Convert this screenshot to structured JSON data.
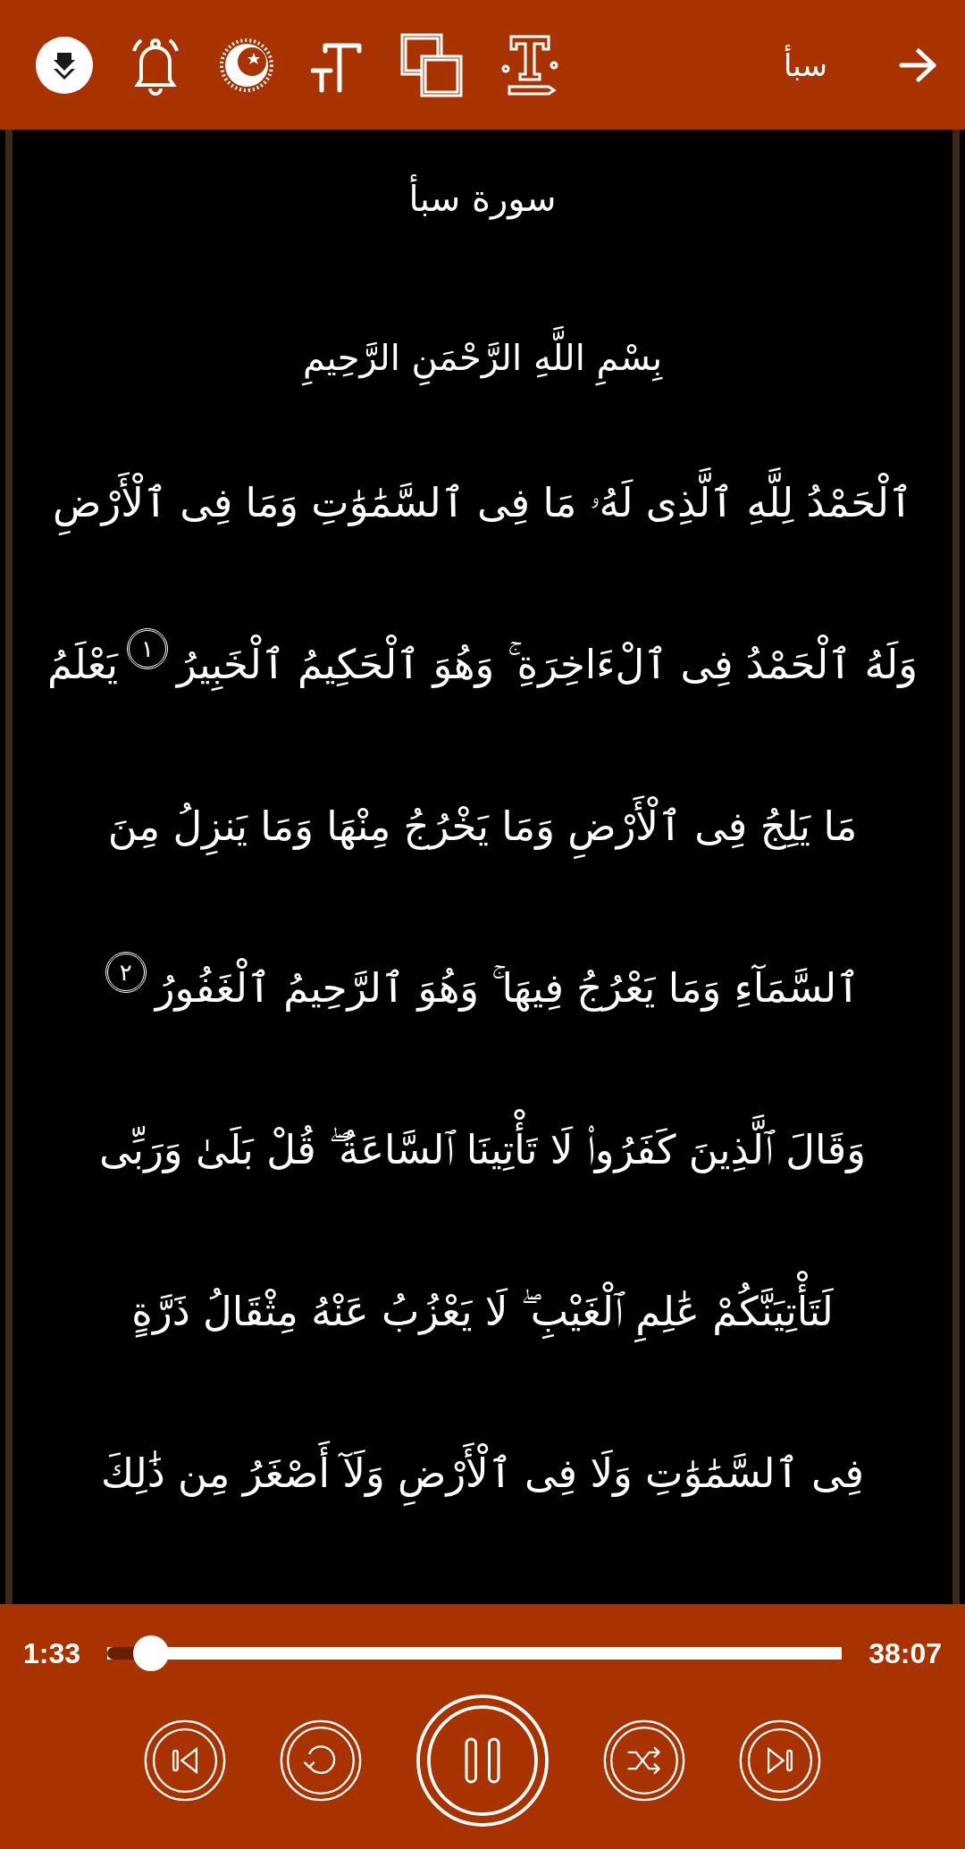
{
  "top_bar": {
    "title": "سبأ"
  },
  "surah": {
    "title": "سورة سبأ",
    "basmala": "بِسْمِ اللَّهِ الرَّحْمَنِ الرَّحِيمِ",
    "lines": [
      [
        {
          "kind": "text",
          "text": "ٱلْحَمْدُ لِلَّهِ ٱلَّذِى لَهُۥ مَا فِى ٱلسَّمَٰوَٰتِ وَمَا فِى ٱلْأَرْضِ"
        }
      ],
      [
        {
          "kind": "text",
          "text": "وَلَهُ ٱلْحَمْدُ فِى ٱلْءَاخِرَةِ ۚ وَهُوَ ٱلْحَكِيمُ ٱلْخَبِيرُ"
        },
        {
          "kind": "ayah",
          "text": "١"
        },
        {
          "kind": "text",
          "text": "يَعْلَمُ"
        }
      ],
      [
        {
          "kind": "text",
          "text": "مَا يَلِجُ فِى ٱلْأَرْضِ وَمَا يَخْرُجُ مِنْهَا وَمَا يَنزِلُ مِنَ"
        }
      ],
      [
        {
          "kind": "text",
          "text": "ٱلسَّمَآءِ وَمَا يَعْرُجُ فِيهَا ۚ وَهُوَ ٱلرَّحِيمُ ٱلْغَفُورُ"
        },
        {
          "kind": "ayah",
          "text": "٢"
        }
      ],
      [
        {
          "kind": "text",
          "text": "وَقَالَ ٱلَّذِينَ كَفَرُوا۟ لَا تَأْتِينَا ٱلسَّاعَةُ ۖ قُلْ بَلَىٰ وَرَبِّى"
        }
      ],
      [
        {
          "kind": "text",
          "text": "لَتَأْتِيَنَّكُمْ عَٰلِمِ ٱلْغَيْبِ ۖ لَا يَعْزُبُ عَنْهُ مِثْقَالُ ذَرَّةٍ"
        }
      ],
      [
        {
          "kind": "text",
          "text": "فِى ٱلسَّمَٰوَٰتِ وَلَا فِى ٱلْأَرْضِ وَلَآ أَصْغَرُ مِن ذَٰلِكَ"
        }
      ]
    ]
  },
  "player": {
    "elapsed": "1:33",
    "total": "38:07",
    "level": 0.06
  }
}
